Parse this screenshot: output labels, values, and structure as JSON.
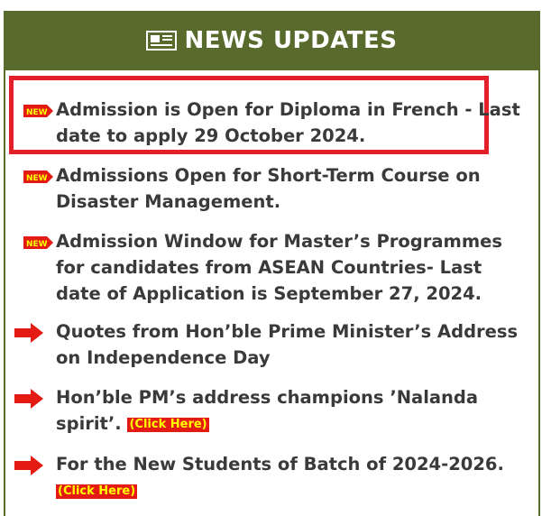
{
  "header": {
    "title": "NEWS UPDATES",
    "icon": "newspaper-icon",
    "background_color": "#586a2c"
  },
  "highlight_color": "#e3202a",
  "items": [
    {
      "text": "Admission is Open for Diploma in French - Last date to apply 29 October 2024.",
      "marker": "new-badge-icon",
      "highlighted": true
    },
    {
      "text": "Admissions Open for Short-Term Course on Disaster Management.",
      "marker": "new-badge-icon"
    },
    {
      "text": "Admission Window for Master’s Programmes for candidates from ASEAN Countries- Last date of Application is September 27, 2024.",
      "marker": "new-badge-icon"
    },
    {
      "text": "Quotes from Hon’ble Prime Minister’s Address on Independence Day",
      "marker": "red-arrow-icon"
    },
    {
      "text": "Hon’ble PM’s address champions ’Nalanda spirit’.",
      "marker": "red-arrow-icon",
      "link": "(Click Here)"
    },
    {
      "text": "For the New Students of Batch of 2024-2026.",
      "marker": "red-arrow-icon",
      "link": "(Click Here)"
    }
  ]
}
